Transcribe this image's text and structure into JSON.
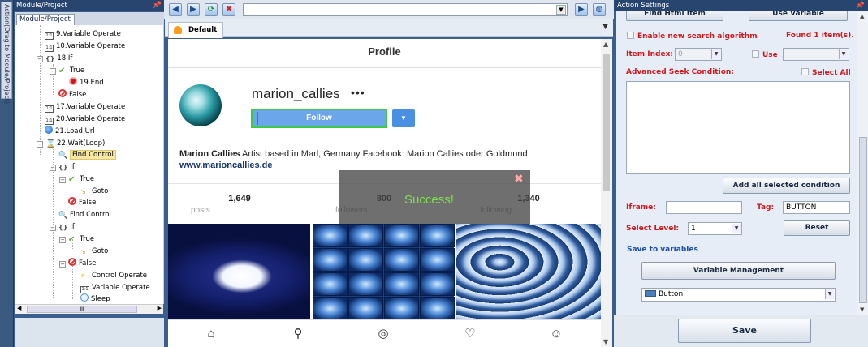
{
  "left_strip": {
    "tab_label": "Action(Drag to Module/Project)"
  },
  "left_panel": {
    "title": "Module/Project",
    "tab": "Module/Project",
    "tree": [
      {
        "label": "9.Variable Operate",
        "icon": "variable-icon"
      },
      {
        "label": "10.Variable Operate",
        "icon": "variable-icon"
      },
      {
        "label": "18.If",
        "icon": "if-icon"
      },
      {
        "label": "True",
        "icon": "true-check-icon"
      },
      {
        "label": "19.End",
        "icon": "end-icon"
      },
      {
        "label": "False",
        "icon": "false-icon"
      },
      {
        "label": "17.Variable Operate",
        "icon": "variable-icon"
      },
      {
        "label": "20.Variable Operate",
        "icon": "variable-icon"
      },
      {
        "label": "21.Load Url",
        "icon": "globe-icon"
      },
      {
        "label": "22.Wait(Loop)",
        "icon": "hourglass-icon"
      },
      {
        "label": "Find Control",
        "icon": "find-control-icon"
      },
      {
        "label": "If",
        "icon": "if-icon"
      },
      {
        "label": "True",
        "icon": "true-check-icon"
      },
      {
        "label": "Goto",
        "icon": "goto-icon"
      },
      {
        "label": "False",
        "icon": "false-icon"
      },
      {
        "label": "Find Control",
        "icon": "find-control-icon"
      },
      {
        "label": "If",
        "icon": "if-icon"
      },
      {
        "label": "True",
        "icon": "true-check-icon"
      },
      {
        "label": "Goto",
        "icon": "goto-icon"
      },
      {
        "label": "False",
        "icon": "false-icon"
      },
      {
        "label": "Control Operate",
        "icon": "control-operate-icon"
      },
      {
        "label": "Variable Operate",
        "icon": "variable-icon"
      },
      {
        "label": "Sleep",
        "icon": "sleep-icon"
      }
    ],
    "selected": "Find Control",
    "hscroll_grip": "III"
  },
  "browser": {
    "tab_label": "Default",
    "url": "",
    "page": {
      "title": "Profile",
      "username": "marion_callies",
      "more": "•••",
      "follow_label": "Follow",
      "bio_name": "Marion Callies",
      "bio_text": " Artist based in Marl, Germany Facebook: Marion Callies oder Goldmund",
      "bio_link": "www.marioncallies.de",
      "stats": [
        {
          "num": "1,649",
          "label": "posts"
        },
        {
          "num": "800",
          "label": "followers"
        },
        {
          "num": "1,340",
          "label": "following"
        }
      ]
    },
    "toast": {
      "message": "Success!",
      "close": "✖"
    }
  },
  "right_panel": {
    "title": "Action Settings",
    "find_html_button": "Find Html Item",
    "use_variable_button": "Use Variable",
    "enable_search": "Enable new search algorithm",
    "found_text": "Found 1 item(s).",
    "item_index_label": "Item Index:",
    "item_index_value": "0",
    "use_label": "Use",
    "use_value": "",
    "advanced_label": "Advanced Seek Condition:",
    "select_all_label": "Select All",
    "add_condition_button": "Add all selected condition",
    "iframe_label": "Iframe:",
    "iframe_value": "",
    "tag_label": "Tag:",
    "tag_value": "BUTTON",
    "select_level_label": "Select Level:",
    "select_level_value": "1",
    "reset_button": "Reset",
    "save_to_variables": "Save to variables",
    "variable_management_button": "Variable Management",
    "variable_type_value": "Button",
    "save_button": "Save"
  }
}
